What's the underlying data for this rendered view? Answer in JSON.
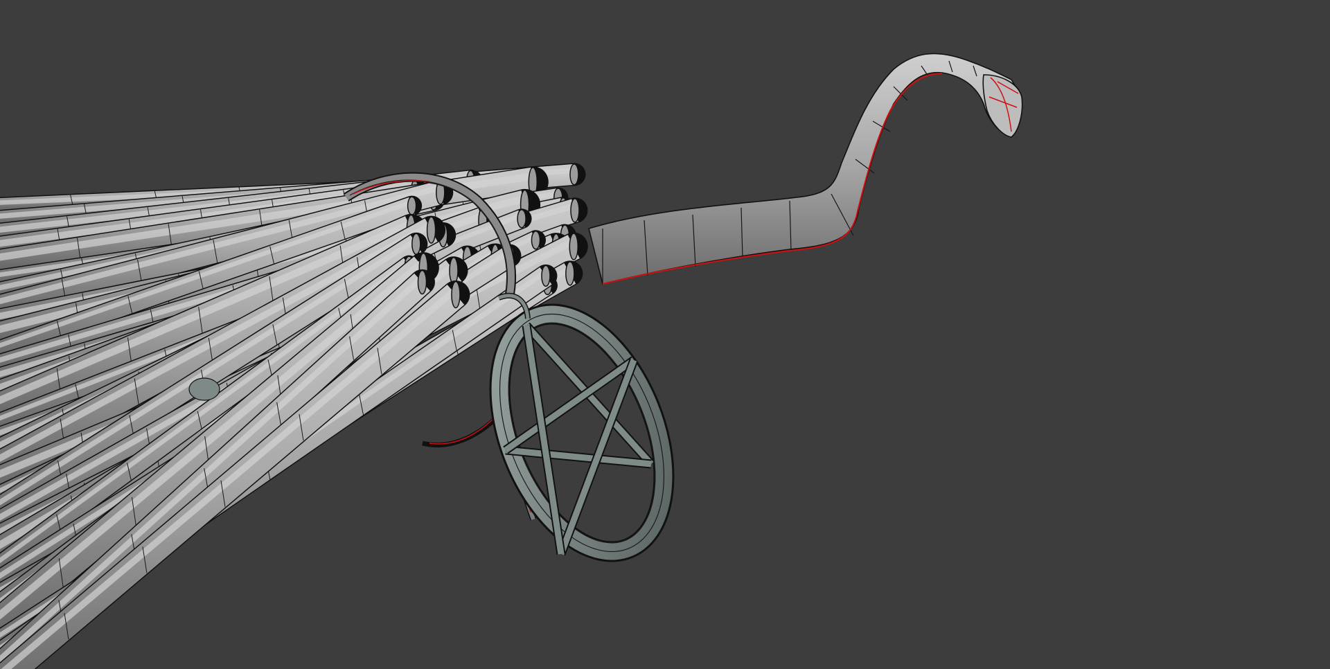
{
  "viewport": {
    "background_color": "#3d3d3d",
    "object_surface_color": "#a8a8a8",
    "object_shadow_color": "#6e6e6e",
    "wire_color": "#111111",
    "seam_color": "#d01010",
    "pendant_color": "#7f8b89",
    "pendant_shadow_color": "#4c5654",
    "model": {
      "description_icon": "broom-mesh-object",
      "parts": [
        "bristles",
        "binding-cord",
        "broom-handle",
        "pentagram-pendant",
        "hook-tip"
      ]
    }
  }
}
